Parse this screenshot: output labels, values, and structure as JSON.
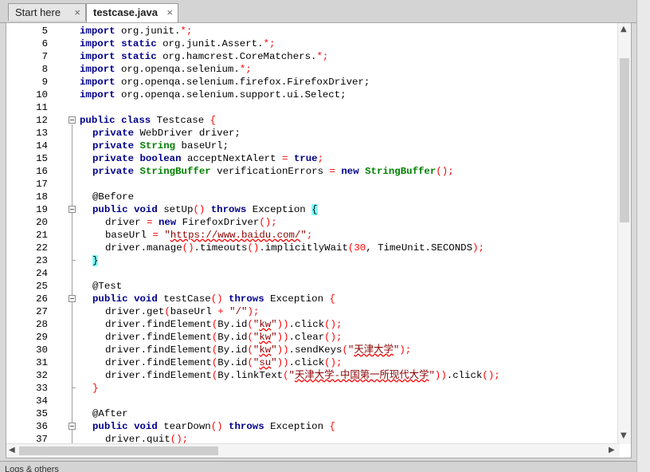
{
  "tabs": [
    {
      "label": "Start here",
      "close": "×"
    },
    {
      "label": "testcase.java",
      "close": "×"
    }
  ],
  "editor": {
    "lines": [
      {
        "n": "5"
      },
      {
        "n": "6"
      },
      {
        "n": "7"
      },
      {
        "n": "8"
      },
      {
        "n": "9"
      },
      {
        "n": "10"
      },
      {
        "n": "11"
      },
      {
        "n": "12"
      },
      {
        "n": "13"
      },
      {
        "n": "14"
      },
      {
        "n": "15"
      },
      {
        "n": "16"
      },
      {
        "n": "17"
      },
      {
        "n": "18"
      },
      {
        "n": "19"
      },
      {
        "n": "20"
      },
      {
        "n": "21"
      },
      {
        "n": "22"
      },
      {
        "n": "23"
      },
      {
        "n": "24"
      },
      {
        "n": "25"
      },
      {
        "n": "26"
      },
      {
        "n": "27"
      },
      {
        "n": "28"
      },
      {
        "n": "29"
      },
      {
        "n": "30"
      },
      {
        "n": "31"
      },
      {
        "n": "32"
      },
      {
        "n": "33"
      },
      {
        "n": "34"
      },
      {
        "n": "35"
      },
      {
        "n": "36"
      },
      {
        "n": "37"
      }
    ],
    "tokens": {
      "import": "import",
      "static": "static",
      "public": "public",
      "class": "class",
      "private": "private",
      "boolean": "boolean",
      "true": "true",
      "new": "new",
      "void": "void",
      "throws": "throws",
      "String": "String",
      "StringBuffer": "StringBuffer",
      "l5": " org.junit.",
      "l5b": ";",
      "l6": " org.junit.Assert.",
      "l7": " org.hamcrest.CoreMatchers.",
      "l8": " org.openqa.selenium.",
      "l9": " org.openqa.selenium.firefox.FirefoxDriver;",
      "l10": " org.openqa.selenium.support.ui.Select;",
      "star": "*",
      "l12": " Testcase ",
      "l13": " WebDriver driver;",
      "l14": " baseUrl;",
      "l15": " acceptNextAlert ",
      "l16": " verificationErrors ",
      "eq": "=",
      "semi": ";",
      "lbrace": "{",
      "rbrace": "}",
      "paren": "()",
      "lp": "(",
      "rp": ")",
      "l18": "@Before",
      "l19": " setUp",
      "exc": " Exception ",
      "l20a": "driver ",
      "l20b": " FirefoxDriver",
      "l21a": "baseUrl ",
      "l21s1": "\"",
      "l21s2": "https://www.baidu.com/",
      "l21s3": "\"",
      "l22a": "driver.manage",
      "l22b": ".timeouts",
      "l22c": ".implicitlyWait",
      "l22d": "30",
      "l22e": ", TimeUnit.SECONDS",
      "l25": "@Test",
      "l26": " testCase",
      "l27a": "driver.get",
      "l27b": "baseUrl ",
      "plus": "+",
      "l27c": " \"/\"",
      "fe": "driver.findElement",
      "byid": "By.id",
      "kw_id": "kw",
      "su_id": "su",
      "q": "\"",
      "click": ".click",
      "clear": ".clear",
      "sendkeys": ".sendKeys",
      "tju": "天津大学",
      "bylink": "By.linkText",
      "linktext": "天津大学-中国第一所现代大学",
      "l35": "@After",
      "l36": " tearDown",
      "l37": "driver.quit"
    }
  },
  "status_bar": {
    "label": "Logs & others"
  }
}
